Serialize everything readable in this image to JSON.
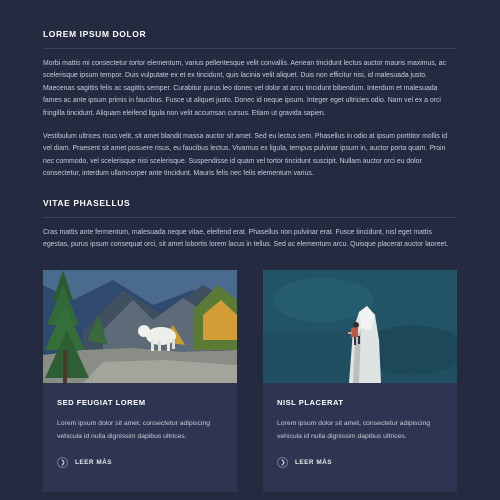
{
  "section1": {
    "heading": "LOREM IPSUM DOLOR",
    "para1": "Morbi mattis mi consectetur tortor elementum, varius pellentesque velit convallis. Aenean tincidunt lectus auctor mauris maximus, ac scelerisque ipsum tempor. Duis vulputate ex et ex tincidunt, quis lacinia velit aliquet. Duis non efficitur nisi, id malesuada justo. Maecenas sagittis felis ac sagittis semper. Curabitur purus leo donec vel dolor at arcu tincidunt bibendum. Interdum et malesuada fames ac ante ipsum primis in faucibus. Fusce ut aliquet justo. Donec id neque ipsum. Integer eget ultricies odio. Nam vel ex a orci fringilla tincidunt. Aliquam eleifend ligula non velit accumsan cursus. Etiam ut gravida sapien.",
    "para2": "Vestibulum ultrices risus velit, sit amet blandit massa auctor sit amet. Sed eu lectus sem. Phasellus in odio at ipsum porttitor mollis id vel diam. Praesent sit amet posuere risus, eu faucibus lectus. Vivamus ex ligula, tempus pulvinar ipsum in, auctor porta quam. Proin nec commodo, vel scelerisque nisi scelerisque. Suspendisse id quam vel tortor tincidunt suscipit. Nullam auctor orci eu dolor consectetur, interdum ullamcorper ante tincidunt. Mauris felis nec felis elementum varius."
  },
  "section2": {
    "heading": "VITAE PHASELLUS",
    "para": "Cras mattis ante fermentum, malesuada neque vitae, eleifend erat. Phasellus non pulvinar erat. Fusce tincidunt, nisl eget mattis egestas, purus ipsum consequat orci, sit amet lobortis lorem lacus in tellus. Sed ac elementum arcu. Quisque placerat auctor laoreet."
  },
  "cards": [
    {
      "title": "SED FEUGIAT LOREM",
      "text": "Lorem ipsum dolor sit amet, consectetur adipiscing vehicula id nulla dignissim dapibus ultrices.",
      "more": "LEER MÁS",
      "image": "mountain-goat-photo"
    },
    {
      "title": "NISL PLACERAT",
      "text": "Lorem ipsum dolor sit amet, consectetur adipiscing vehicula id nulla dignissim dapibus ultrices.",
      "more": "LEER MÁS",
      "image": "rock-climber-photo"
    }
  ],
  "icons": {
    "more": "chevron-right-icon"
  },
  "colors": {
    "background": "#242a3f",
    "card": "#2e3550",
    "heading": "#ffffff"
  }
}
